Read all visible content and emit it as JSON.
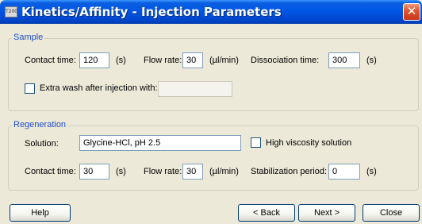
{
  "window": {
    "icon_text": "T200",
    "title": "Kinetics/Affinity - Injection Parameters",
    "close_symbol": "✕"
  },
  "sample": {
    "legend": "Sample",
    "contact_time_label": "Contact time:",
    "contact_time_value": "120",
    "contact_time_unit": "(s)",
    "flow_rate_label": "Flow rate:",
    "flow_rate_value": "30",
    "flow_rate_unit": "(µl/min)",
    "dissociation_time_label": "Dissociation time:",
    "dissociation_time_value": "300",
    "dissociation_time_unit": "(s)",
    "extra_wash_label": "Extra wash after injection with:",
    "extra_wash_checked": false,
    "extra_wash_value": ""
  },
  "regeneration": {
    "legend": "Regeneration",
    "solution_label": "Solution:",
    "solution_value": "Glycine-HCl, pH 2.5",
    "high_viscosity_label": "High viscosity solution",
    "high_viscosity_checked": false,
    "contact_time_label": "Contact time:",
    "contact_time_value": "30",
    "contact_time_unit": "(s)",
    "flow_rate_label": "Flow rate:",
    "flow_rate_value": "30",
    "flow_rate_unit": "(µl/min)",
    "stabilization_label": "Stabilization period:",
    "stabilization_value": "0",
    "stabilization_unit": "(s)"
  },
  "buttons": {
    "help": "Help",
    "back": "< Back",
    "next": "Next >",
    "close": "Close"
  },
  "colors": {
    "titlebar": "#0055e5",
    "dialog_background": "#ece9d8",
    "group_legend": "#1f4ec7",
    "close_button": "#e2572e"
  }
}
